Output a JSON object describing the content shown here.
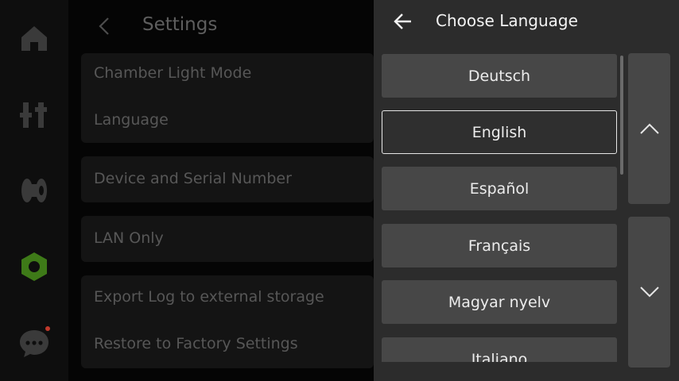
{
  "nav": {
    "items": [
      {
        "id": "home",
        "icon": "home-icon",
        "active": false
      },
      {
        "id": "controls",
        "icon": "sliders-icon",
        "active": false
      },
      {
        "id": "filament",
        "icon": "filament-spool-icon",
        "active": false
      },
      {
        "id": "settings",
        "icon": "hex-nut-settings-icon",
        "active": true
      },
      {
        "id": "messages",
        "icon": "chat-bubble-icon",
        "active": false,
        "has_notification": true
      }
    ],
    "colors": {
      "icon": "#3a3a3a",
      "active": "#3e7a18",
      "notification": "#c0392b"
    }
  },
  "settings": {
    "title": "Settings",
    "back_icon": "chevron-left-icon",
    "groups": [
      {
        "items": [
          "Chamber Light Mode",
          "Language"
        ]
      },
      {
        "items": [
          "Device and Serial Number"
        ]
      },
      {
        "items": [
          "LAN Only"
        ]
      },
      {
        "items": [
          "Export Log to external storage",
          "Restore to Factory Settings"
        ]
      }
    ]
  },
  "language_dialog": {
    "title": "Choose Language",
    "back_icon": "arrow-left-icon",
    "languages": [
      "Deutsch",
      "English",
      "Español",
      "Français",
      "Magyar nyelv",
      "Italiano"
    ],
    "selected": "English",
    "page_up_icon": "chevron-up-icon",
    "page_down_icon": "chevron-down-icon"
  }
}
